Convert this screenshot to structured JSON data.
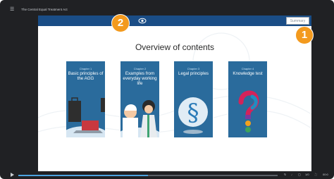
{
  "window": {
    "title": "The Central Equal Treatment Act",
    "menu_icon": "hamburger-icon"
  },
  "slide": {
    "summary_button_label": "Summary",
    "heading": "Overview of contents",
    "logo_icon": "eye-logo-icon",
    "cards": [
      {
        "chapter": "Chapter 1",
        "title": "Basic principles of the AGG",
        "illustration": "office-desk-illustration"
      },
      {
        "chapter": "Chapter 2",
        "title": "Examples from everyday working life",
        "illustration": "people-illustration"
      },
      {
        "chapter": "Chapter 3",
        "title": "Legal principles",
        "illustration": "paragraph-sign-illustration"
      },
      {
        "chapter": "Chapter 4",
        "title": "Knowledge test",
        "illustration": "question-mark-illustration"
      }
    ],
    "colors": {
      "header": "#1a4d86",
      "card": "#2a6b9c",
      "badge": "#f39a1e"
    }
  },
  "badges": {
    "one": "1",
    "two": "2"
  },
  "player": {
    "progress_fraction": 0.5,
    "time_readout": "00:0",
    "page_readout": "1/0",
    "controls": [
      "play-icon",
      "replay-icon",
      "volume-icon",
      "captions-icon",
      "fullscreen-icon"
    ]
  }
}
